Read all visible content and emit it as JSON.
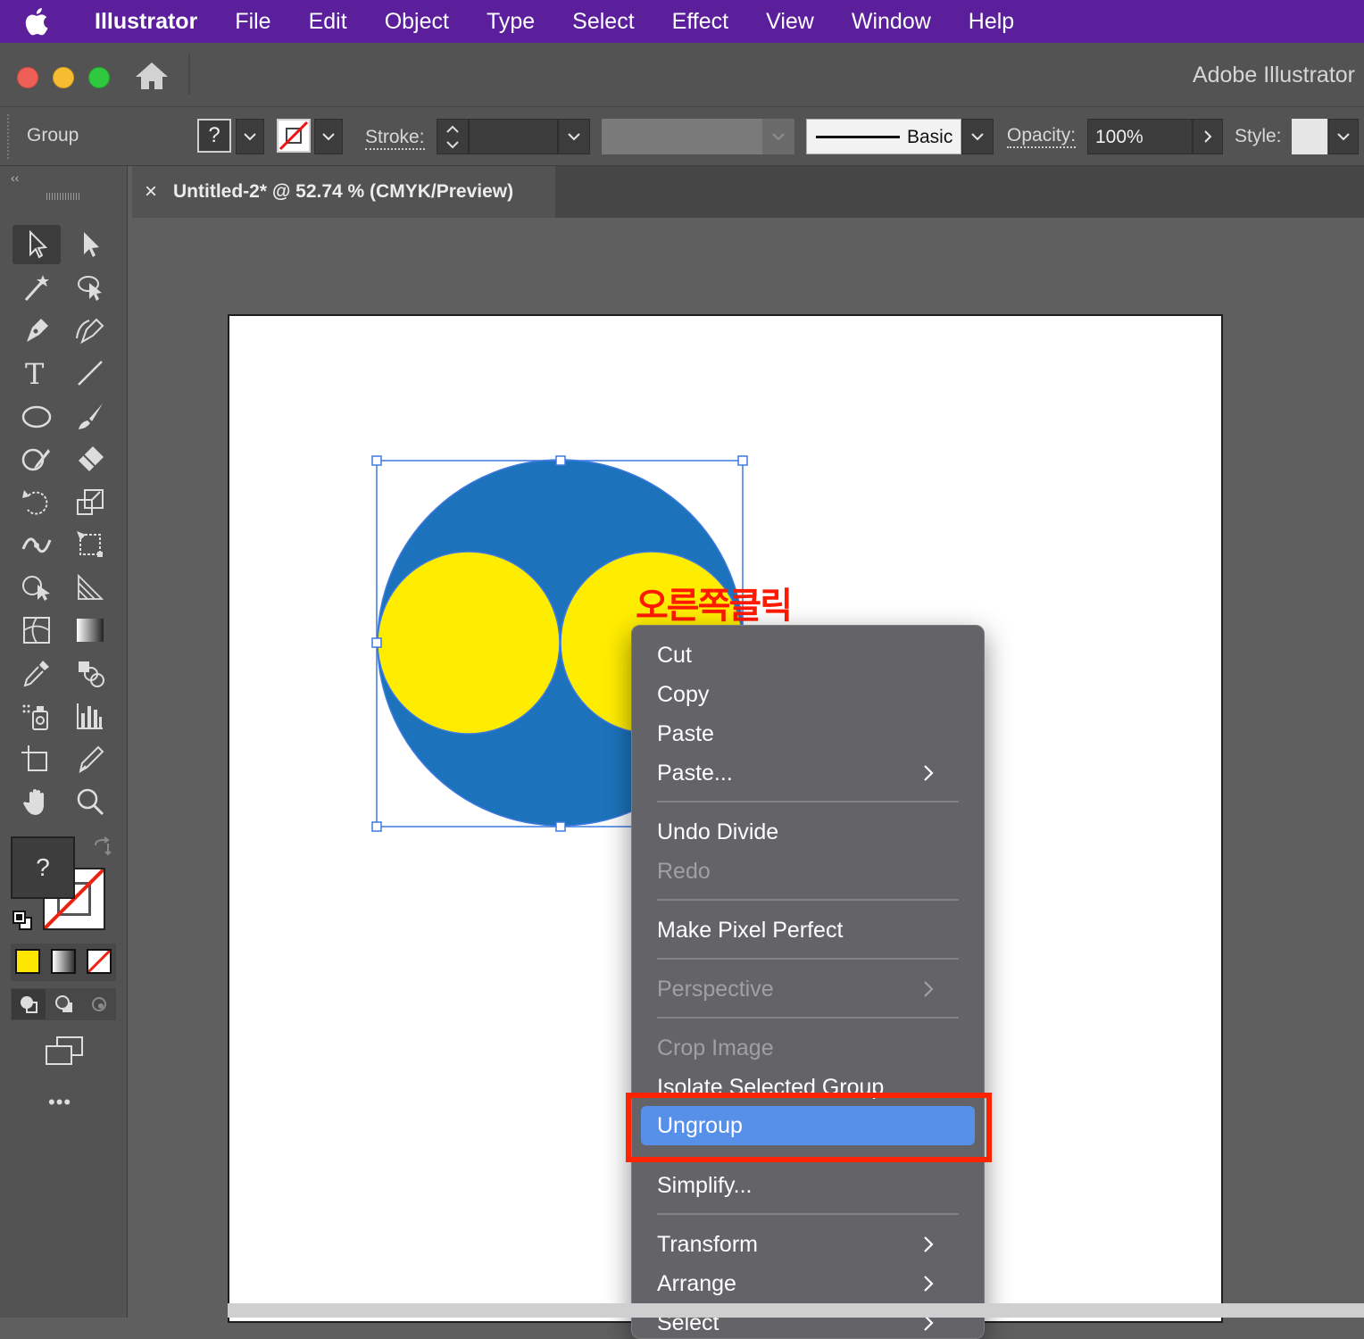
{
  "menubar": {
    "app_name": "Illustrator",
    "items": [
      "File",
      "Edit",
      "Object",
      "Type",
      "Select",
      "Effect",
      "View",
      "Window",
      "Help"
    ]
  },
  "window": {
    "title": "Adobe Illustrator"
  },
  "controlbar": {
    "selection_type": "Group",
    "fill_unknown": "?",
    "stroke_label": "Stroke:",
    "brush_label": "Basic",
    "opacity_label": "Opacity:",
    "opacity_value": "100%",
    "style_label": "Style:"
  },
  "document": {
    "tab_title": "Untitled-2* @ 52.74 % (CMYK/Preview)",
    "close_glyph": "×"
  },
  "toolbar": {
    "fill_unknown": "?",
    "more": "•••"
  },
  "canvas": {
    "annotation": "오른쪽클릭"
  },
  "colors": {
    "blue_circle": "#1c73bb",
    "yellow_circle": "#ffed00",
    "highlight_box": "#ff2400",
    "menu_highlight": "#5790e8"
  },
  "context_menu": {
    "items": [
      {
        "label": "Cut",
        "enabled": true
      },
      {
        "label": "Copy",
        "enabled": true
      },
      {
        "label": "Paste",
        "enabled": true
      },
      {
        "label": "Paste...",
        "enabled": true,
        "submenu": true
      },
      {
        "label": "Undo Divide",
        "enabled": true
      },
      {
        "label": "Redo",
        "enabled": false
      },
      {
        "label": "Make Pixel Perfect",
        "enabled": true
      },
      {
        "label": "Perspective",
        "enabled": false,
        "submenu": true
      },
      {
        "label": "Crop Image",
        "enabled": false
      },
      {
        "label": "Isolate Selected Group",
        "enabled": true
      },
      {
        "label": "Ungroup",
        "enabled": true,
        "highlighted": true
      },
      {
        "label": "Simplify...",
        "enabled": true
      },
      {
        "label": "Transform",
        "enabled": true,
        "submenu": true
      },
      {
        "label": "Arrange",
        "enabled": true,
        "submenu": true
      },
      {
        "label": "Select",
        "enabled": true,
        "submenu": true
      }
    ]
  }
}
